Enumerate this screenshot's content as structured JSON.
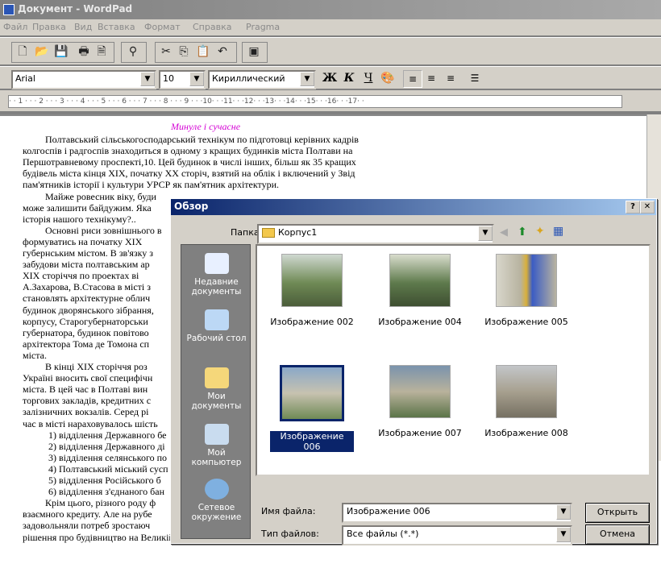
{
  "window": {
    "title": "Документ - WordPad"
  },
  "menu": [
    "Файл",
    "Правка",
    "Вид",
    "Вставка",
    "Формат",
    "Справка",
    "Pragma"
  ],
  "format_bar": {
    "font": "Arial",
    "size": "10",
    "script": "Кириллический",
    "bold": "Ж",
    "italic": "К",
    "underline": "Ч"
  },
  "ruler": {
    "marks": "· · 1 · · · 2 · · · 3 · · · 4 · · · 5 · · · 6 · · · 7 · · · 8 · · · 9 · · ·10· · ·11· · ·12· · ·13· · ·14· · ·15· · ·16· · ·17· ·"
  },
  "document": {
    "heading": "Минуле і сучасне",
    "lines": [
      "Полтавський сільськогосподарський технікум по підготовці керівних кадрів",
      "колгоспів і радгоспів знаходиться в одному з кращих будинків міста Полтави на",
      "Першотравневому проспекті,10. Цей будинок в числі інших, більш як 35 кращих",
      "будівель міста кінця XIX, початку XX сторіч, взятий на облік і включений у Звід",
      "пам'ятників історії і культури УРСР як пам'ятник архітектури.",
      "Майже ровесник віку, буди",
      "може залишити байдужим. Яка",
      "історія нашого технікуму?..",
      "Основні риси зовнішнього в",
      "формуватись на початку XIX",
      "губернським містом. В зв'язку з",
      "забудови міста полтавським ар",
      "XIX сторіччя по проектах ві",
      "А.Захарова, В.Стасова в місті з",
      "становлять архітектурне облич",
      "будинок дворянського зібрання,",
      "корпусу, Старогубернаторськи",
      "губернатора, будинок повітово",
      "архітектора Тома де Томона сп",
      "міста.",
      "В кінці XIX сторіччя роз",
      "Україні вносить свої специфічн",
      "міста. В цей час в Полтаві вин",
      "торгових закладів, кредитних с",
      "залізничних вокзалів. Серед рі",
      "час в місті нараховувалось шість",
      "1) відділення Державного бе",
      "2) відділення Державного ді",
      "3) відділення селянського по",
      "4) Полтавський міський сусп",
      "5) відділення Російського б",
      "6) відділення з'єднаного бан",
      "Крім цього, різного роду ф",
      "взаємного кредиту. Але на рубе",
      "задовольняли потреб зростаюч",
      "рішення про будівництво на Великій Петрівській вулиці будинку Полтавського"
    ]
  },
  "dialog": {
    "title": "Обзор",
    "folder_label": "Папка:",
    "folder_value": "Корпус1",
    "places": [
      {
        "label": "Недавние документы",
        "icon": "recent-documents-icon",
        "color": "#e8f0ff"
      },
      {
        "label": "Рабочий стол",
        "icon": "desktop-icon",
        "color": "#bcd8f5"
      },
      {
        "label": "Мои документы",
        "icon": "my-documents-icon",
        "color": "#f5d77a"
      },
      {
        "label": "Мой компьютер",
        "icon": "my-computer-icon",
        "color": "#c9dcef"
      },
      {
        "label": "Сетевое окружение",
        "icon": "network-icon",
        "color": "#7fb0e0"
      }
    ],
    "files": [
      {
        "name": "Изображение 002",
        "color": "#6f8a55",
        "selected": false
      },
      {
        "name": "Изображение 004",
        "color": "#5e7a4c",
        "selected": false
      },
      {
        "name": "Изображение 005",
        "color": "#b8b3a0",
        "selected": false
      },
      {
        "name": "Изображение 006",
        "color": "#8aa8c8",
        "selected": true
      },
      {
        "name": "Изображение 007",
        "color": "#7a93ad",
        "selected": false
      },
      {
        "name": "Изображение 008",
        "color": "#a7a08f",
        "selected": false
      }
    ],
    "filename_label": "Имя файла:",
    "filename_value": "Изображение 006",
    "filetype_label": "Тип файлов:",
    "filetype_value": "Все файлы (*.*)",
    "open_button": "Открыть",
    "cancel_button": "Отмена"
  }
}
